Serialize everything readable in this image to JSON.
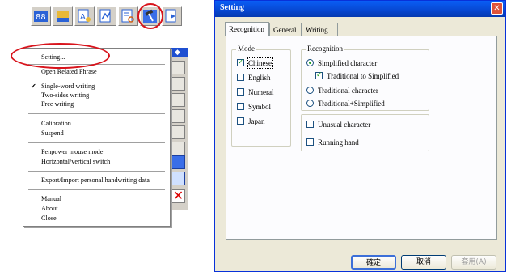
{
  "toolbar": {
    "buttons": [
      "handwriting-pad-icon",
      "keyboard-icon",
      "font-tool-icon",
      "graph-tool-icon",
      "dictionary-tool-icon",
      "hammer-settings-icon",
      "exit-tool-icon"
    ]
  },
  "menu": {
    "items": {
      "setting": "Setting...",
      "open_related_phrase": "Open Related Phrase",
      "single_word": "Single-word writing",
      "two_sides": "Two-sides writing",
      "free_writing": "Free writing",
      "calibration": "Calibration",
      "suspend": "Suspend",
      "penpower_mouse": "Penpower mouse mode",
      "switch": "Horizontal/vertical switch",
      "export_import": "Export/Import personal handwriting data",
      "manual": "Manual",
      "about": "About...",
      "close": "Close"
    },
    "checked": "single_word",
    "check_glyph": "✔"
  },
  "dialog": {
    "title": "Setting",
    "close_glyph": "✕",
    "tabs": [
      "Recognition",
      "General",
      "Writing"
    ],
    "active_tab": "Recognition",
    "mode": {
      "label": "Mode",
      "options": [
        {
          "label": "Chinese",
          "checked": true
        },
        {
          "label": "English",
          "checked": false
        },
        {
          "label": "Numeral",
          "checked": false
        },
        {
          "label": "Symbol",
          "checked": false
        },
        {
          "label": "Japan",
          "checked": false
        }
      ]
    },
    "recognition": {
      "label": "Recognition",
      "simplified": "Simplified character",
      "trad_to_simp": "Traditional to Simplified",
      "traditional": "Traditional character",
      "trad_plus_simp": "Traditional+Simplified",
      "selected": "simplified",
      "trad_to_simp_checked": true
    },
    "extras": {
      "unusual": "Unusual character",
      "running_hand": "Running hand"
    },
    "buttons": {
      "ok": "確定",
      "cancel": "取消",
      "apply": "套用(A)"
    }
  },
  "colors": {
    "highlight_red": "#d8141c",
    "title_blue": "#0747d1",
    "check_green": "#21a121"
  }
}
